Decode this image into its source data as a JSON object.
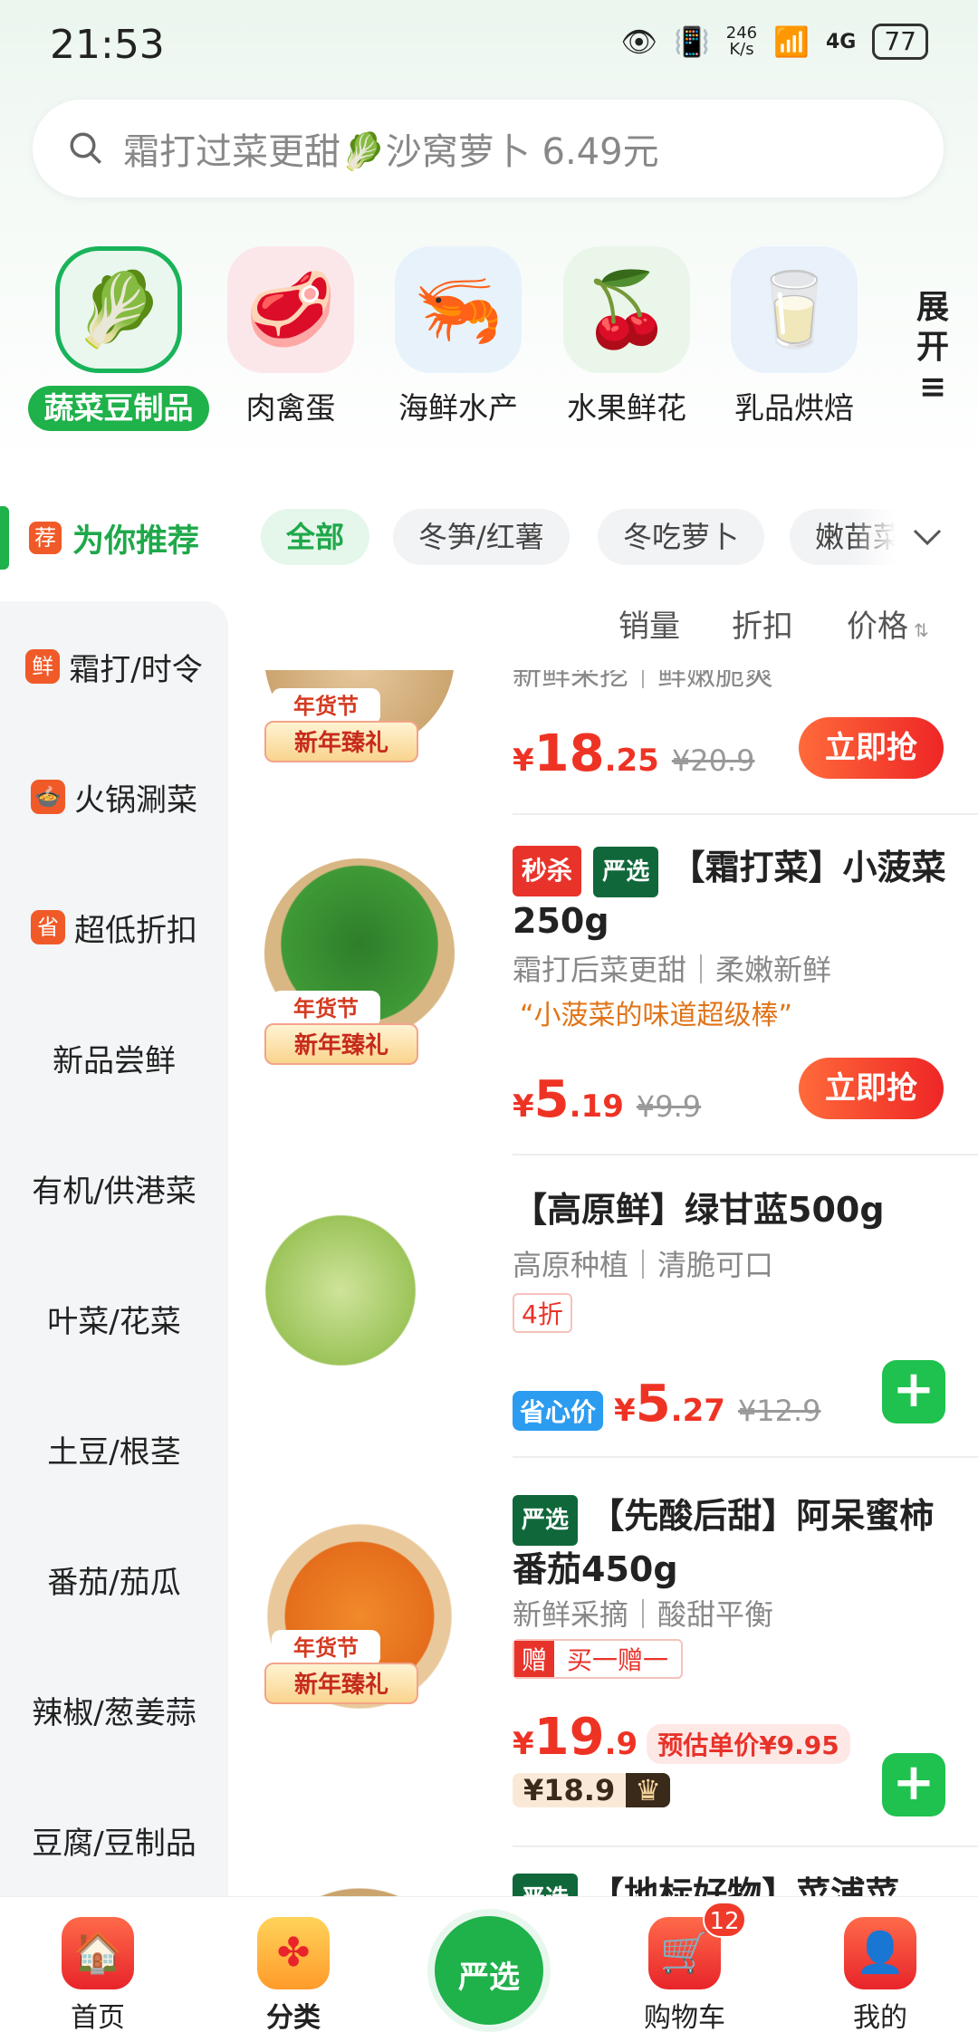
{
  "status_bar": {
    "time": "21:53",
    "speed_value": "246",
    "speed_unit": "K/s",
    "network": "4G",
    "battery": "77"
  },
  "search": {
    "placeholder": "霜打过菜更甜🥬沙窝萝卜 6.49元"
  },
  "categories": [
    {
      "label": "蔬菜豆制品",
      "icon": "🥬"
    },
    {
      "label": "肉禽蛋",
      "icon": "🥩"
    },
    {
      "label": "海鲜水产",
      "icon": "🦐"
    },
    {
      "label": "水果鲜花",
      "icon": "🍒"
    },
    {
      "label": "乳品烘焙",
      "icon": "🥛"
    }
  ],
  "expand": {
    "line1": "展",
    "line2": "开",
    "icon": "≡"
  },
  "recommend": {
    "tag": "荐",
    "label": "为你推荐"
  },
  "chips": [
    "全部",
    "冬笋/红薯",
    "冬吃萝卜",
    "嫩苗菜"
  ],
  "sidebar": [
    {
      "label": "霜打/时令",
      "badge": "鲜"
    },
    {
      "label": "火锅涮菜",
      "badge": "🍲"
    },
    {
      "label": "超低折扣",
      "badge": "省"
    },
    {
      "label": "新品尝鲜"
    },
    {
      "label": "有机/供港菜"
    },
    {
      "label": "叶菜/花菜"
    },
    {
      "label": "土豆/根茎"
    },
    {
      "label": "番茄/茄瓜"
    },
    {
      "label": "辣椒/葱姜蒜"
    },
    {
      "label": "豆腐/豆制品"
    }
  ],
  "sort": {
    "sales": "销量",
    "discount": "折扣",
    "price": "价格"
  },
  "products": [
    {
      "subtitle": "新鲜采挖｜鲜嫩脆爽",
      "promo_top": "年货节",
      "promo_bottom": "新年臻礼",
      "price_symbol": "¥",
      "price_int": "18",
      "price_dec": ".25",
      "old_price": "¥20.9",
      "button": "立即抢"
    },
    {
      "badge1": "秒杀",
      "badge2": "严选",
      "title": "【霜打菜】小菠菜250g",
      "subtitle": "霜打后菜更甜｜柔嫩新鲜",
      "quote": "“小菠菜的味道超级棒”",
      "promo_top": "年货节",
      "promo_bottom": "新年臻礼",
      "price_symbol": "¥",
      "price_int": "5",
      "price_dec": ".19",
      "old_price": "¥9.9",
      "button": "立即抢"
    },
    {
      "title": "【高原鲜】绿甘蓝500g",
      "subtitle": "高原种植｜清脆可口",
      "discount_tag": "4折",
      "price_label": "省心价",
      "price_symbol": "¥",
      "price_int": "5",
      "price_dec": ".27",
      "old_price": "¥12.9",
      "button": "+"
    },
    {
      "badge2": "严选",
      "title": "【先酸后甜】阿呆蜜柿番茄450g",
      "subtitle": "新鲜采摘｜酸甜平衡",
      "gift_tag": "赠",
      "gift_text": "买一赠一",
      "promo_top": "年货节",
      "promo_bottom": "新年臻礼",
      "price_symbol": "¥",
      "price_int": "19",
      "price_dec": ".9",
      "unit_price": "预估单价¥9.95",
      "member_price": "¥18.9",
      "button": "+"
    },
    {
      "badge2": "严选",
      "title": "【地标好物】菜浦菜"
    }
  ],
  "tabbar": [
    {
      "label": "首页",
      "icon": "🏠"
    },
    {
      "label": "分类",
      "icon": "✤"
    },
    {
      "label": "严选"
    },
    {
      "label": "购物车",
      "icon": "🛒",
      "badge": "12"
    },
    {
      "label": "我的",
      "icon": "👤"
    }
  ],
  "colors": {
    "brand_green": "#1fb14a",
    "price_red": "#ee3324",
    "buy_gradient_start": "#ff6a3a"
  }
}
